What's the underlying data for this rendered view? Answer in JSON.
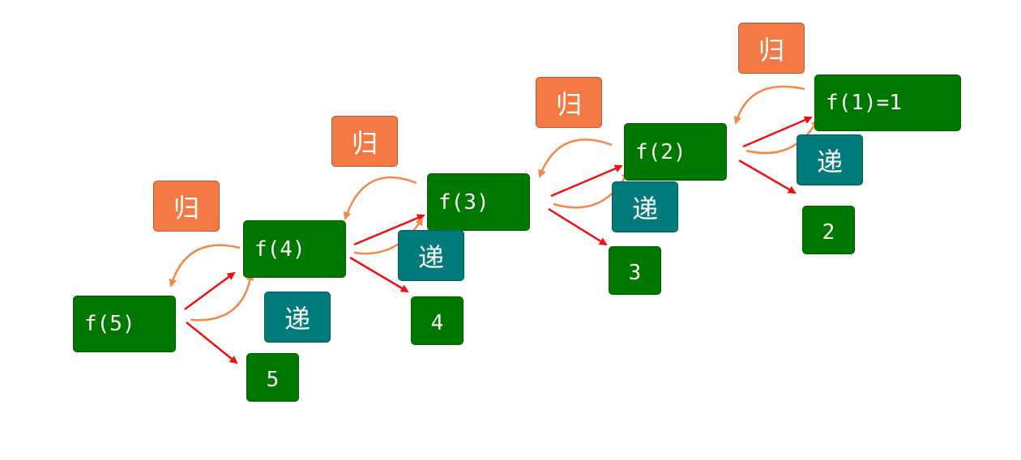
{
  "nodes": {
    "f5": "f(5)",
    "f4": "f(4)",
    "f3": "f(3)",
    "f2": "f(2)",
    "f1": "f(1)=1"
  },
  "values": {
    "v5": "5",
    "v4": "4",
    "v3": "3",
    "v2": "2"
  },
  "labels": {
    "recurse": "递",
    "return": "归"
  },
  "colors": {
    "function_box": "#007800",
    "value_box": "#007800",
    "recurse_label": "#007a7a",
    "return_label": "#f47a45",
    "call_arrow": "#ee1111",
    "return_arrow": "#f4874b"
  }
}
